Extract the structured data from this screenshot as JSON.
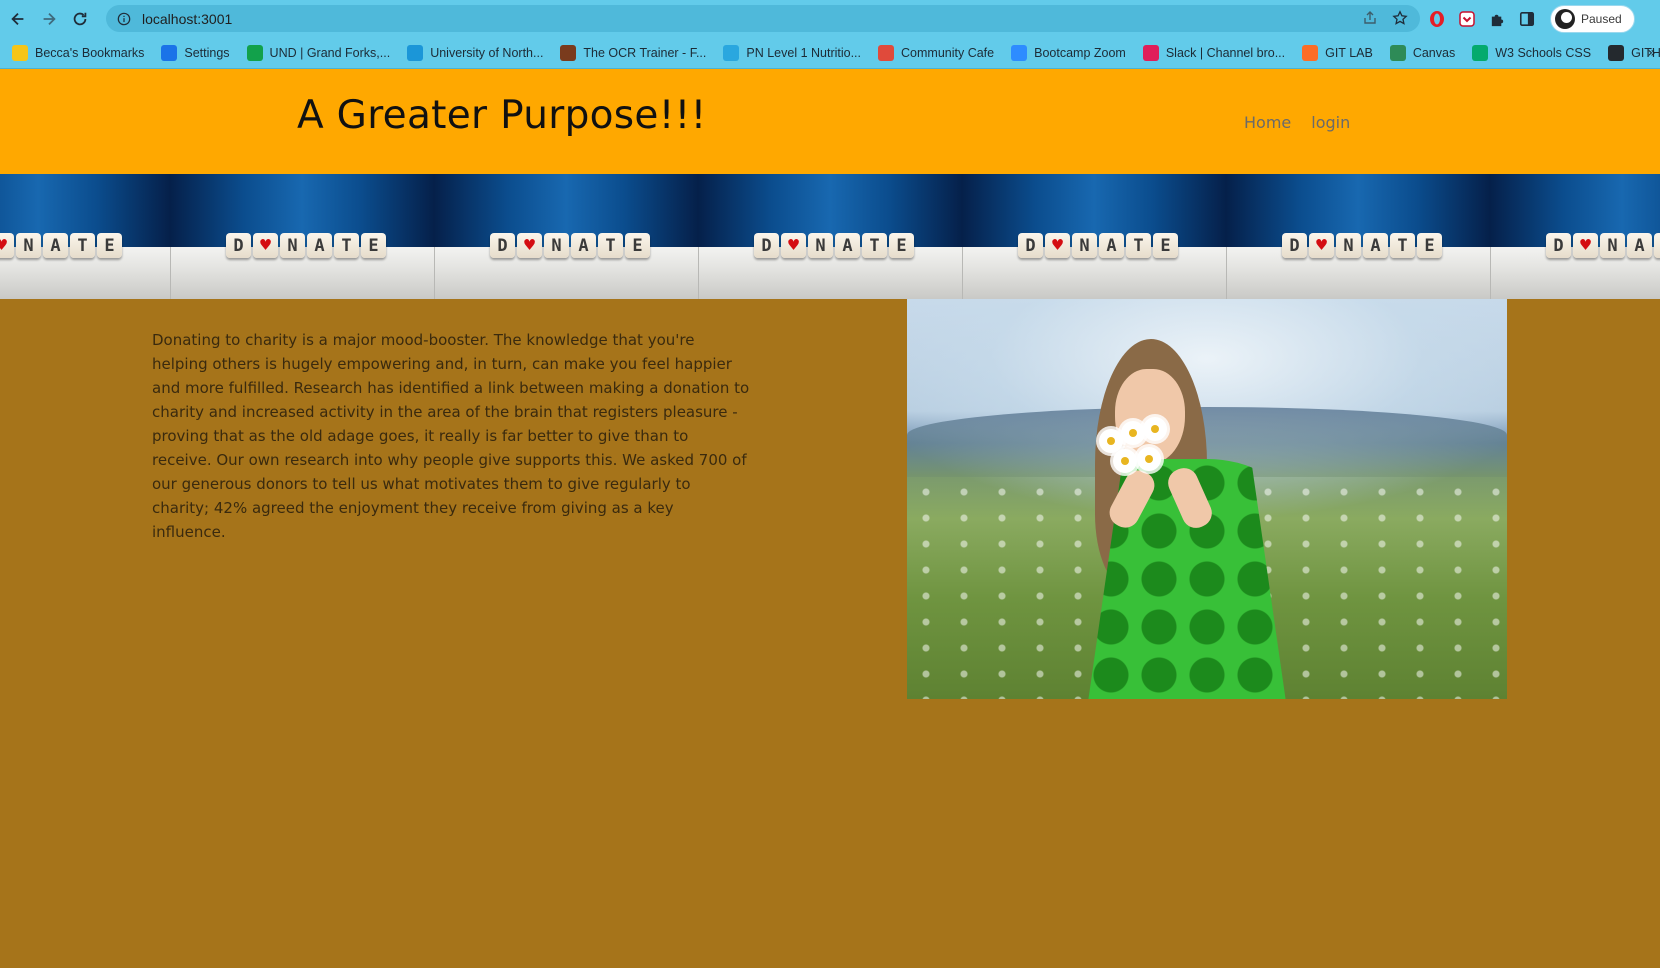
{
  "browser": {
    "url": "localhost:3001",
    "profile_status": "Paused",
    "bookmarks": [
      {
        "label": "Becca's Bookmarks",
        "icon": "folder-icon",
        "color": "#f5c518"
      },
      {
        "label": "Settings",
        "icon": "gear-icon",
        "color": "#1a73e8"
      },
      {
        "label": "UND | Grand Forks,...",
        "icon": "und-icon",
        "color": "#12a14b"
      },
      {
        "label": "University of North...",
        "icon": "cloud-icon",
        "color": "#1b96d8"
      },
      {
        "label": "The OCR Trainer - F...",
        "icon": "ocr-icon",
        "color": "#7a3b1d"
      },
      {
        "label": "PN Level 1 Nutritio...",
        "icon": "pn-icon",
        "color": "#2aa7df"
      },
      {
        "label": "Community Cafe",
        "icon": "chrome-icon",
        "color": "#e04a3b"
      },
      {
        "label": "Bootcamp Zoom",
        "icon": "zoom-icon",
        "color": "#2d8cff"
      },
      {
        "label": "Slack | Channel bro...",
        "icon": "slack-icon",
        "color": "#e01e5a"
      },
      {
        "label": "GIT LAB",
        "icon": "gitlab-icon",
        "color": "#fc6d26"
      },
      {
        "label": "Canvas",
        "icon": "canvas-icon",
        "color": "#2e8b57"
      },
      {
        "label": "W3 Schools CSS",
        "icon": "w3schools-icon",
        "color": "#04aa6d"
      },
      {
        "label": "GITHUB",
        "icon": "github-icon",
        "color": "#24292e"
      }
    ],
    "more_label": "»"
  },
  "header": {
    "title": "A Greater Purpose!!!",
    "nav": [
      "Home",
      "login"
    ]
  },
  "banner": {
    "word": [
      "D",
      "♥",
      "N",
      "A",
      "T",
      "E"
    ]
  },
  "main": {
    "paragraph": "Donating to charity is a major mood-booster. The knowledge that you're helping others is hugely empowering and, in turn, can make you feel happier and more fulfilled. Research has identified a link between making a donation to charity and increased activity in the area of the brain that registers pleasure - proving that as the old adage goes, it really is far better to give than to receive. Our own research into why people give supports this. We asked 700 of our generous donors to tell us what motivates them to give regularly to charity; 42% agreed the enjoyment they receive from giving as a key influence."
  },
  "colors": {
    "header_bg": "#ffa800",
    "page_bg": "#a6741a",
    "browser_chrome": "#62cbea"
  }
}
